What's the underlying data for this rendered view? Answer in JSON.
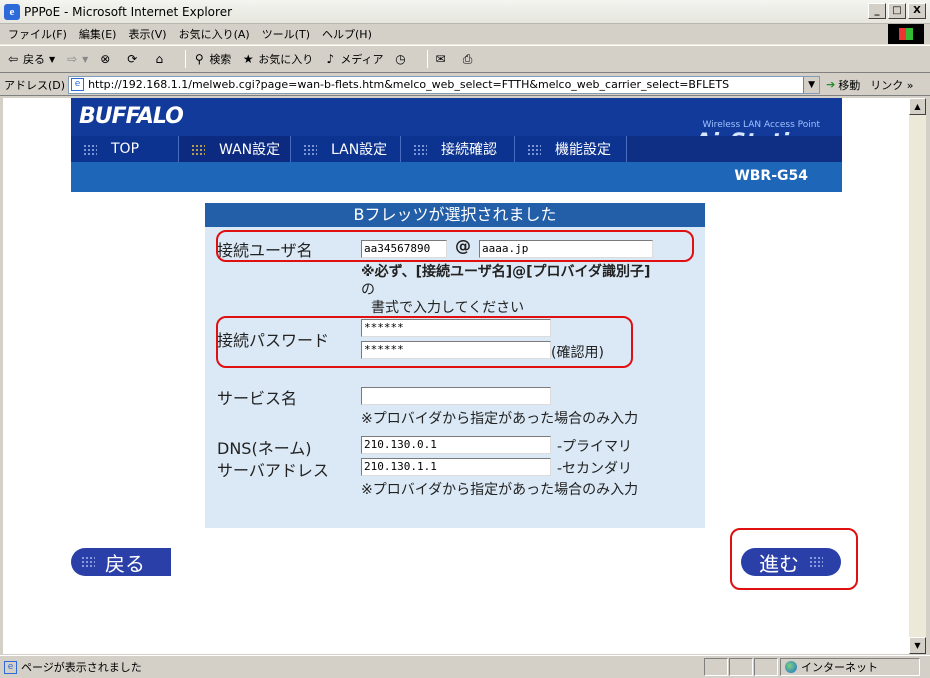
{
  "window": {
    "title": "PPPoE - Microsoft Internet Explorer",
    "minimize": "_",
    "maximize": "□",
    "close": "X"
  },
  "menubar": [
    "ファイル(F)",
    "編集(E)",
    "表示(V)",
    "お気に入り(A)",
    "ツール(T)",
    "ヘルプ(H)"
  ],
  "toolbar": {
    "back": "戻る",
    "search": "検索",
    "favorites": "お気に入り",
    "media": "メディア"
  },
  "addressbar": {
    "label": "アドレス(D)",
    "url": "http://192.168.1.1/melweb.cgi?page=wan-b-flets.htm&melco_web_select=FTTH&melco_web_carrier_select=BFLETS",
    "go": "移動",
    "links": "リンク »"
  },
  "header": {
    "logo": "BUFFALO",
    "wlan_text": "Wireless LAN Access Point",
    "brand": "AirStation",
    "model": "WBR-G54",
    "tabs": [
      "TOP",
      "WAN設定",
      "LAN設定",
      "接続確認",
      "機能設定"
    ]
  },
  "form": {
    "title": "Bフレッツが選択されました",
    "user_label": "接続ユーザ名",
    "user_value": "aa34567890",
    "at": "@",
    "provider_value": "aaaa.jp",
    "user_note_1": "※必ず、[接続ユーザ名]@[プロバイダ識別子]",
    "user_note_2": "の",
    "user_note_3": "書式で入力してください",
    "password_label": "接続パスワード",
    "password_value": "******",
    "password_confirm_value": "******",
    "password_confirm_note": "(確認用)",
    "service_label": "サービス名",
    "service_value": "",
    "service_note": "※プロバイダから指定があった場合のみ入力",
    "dns_label_1": "DNS(ネーム)",
    "dns_label_2": "サーバアドレス",
    "dns_primary": "210.130.0.1",
    "dns_primary_note": "-プライマリ",
    "dns_secondary": "210.130.1.1",
    "dns_secondary_note": "-セカンダリ",
    "dns_note": "※プロバイダから指定があった場合のみ入力"
  },
  "nav": {
    "back": "戻る",
    "next": "進む"
  },
  "status": {
    "text": "ページが表示されました",
    "zone": "インターネット"
  },
  "colors": {
    "highlight": "#e01010",
    "header_blue": "#123a9a",
    "panel_bg": "#dbe9f6"
  }
}
